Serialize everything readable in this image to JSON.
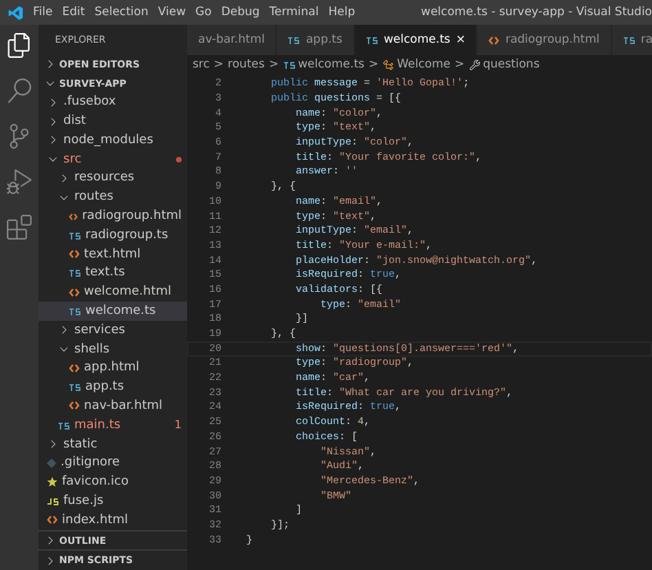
{
  "window": {
    "title": "welcome.ts - survey-app - Visual Studio"
  },
  "menu": [
    "File",
    "Edit",
    "Selection",
    "View",
    "Go",
    "Debug",
    "Terminal",
    "Help"
  ],
  "activity_bar": [
    {
      "kind": "explorer",
      "selected": true
    },
    {
      "kind": "search",
      "selected": false
    },
    {
      "kind": "source-control",
      "selected": false
    },
    {
      "kind": "debug",
      "selected": false
    },
    {
      "kind": "extensions",
      "selected": false
    }
  ],
  "sidebar": {
    "title": "EXPLORER",
    "sections_top": [
      {
        "label": "OPEN EDITORS",
        "expanded": false
      },
      {
        "label": "SURVEY-APP",
        "expanded": true
      }
    ],
    "tree": [
      {
        "label": ".fusebox",
        "kind": "folder",
        "expanded": false
      },
      {
        "label": "dist",
        "kind": "folder",
        "expanded": false
      },
      {
        "label": "node_modules",
        "kind": "folder",
        "expanded": false
      },
      {
        "label": "src",
        "kind": "folder",
        "expanded": true,
        "error": true,
        "children": [
          {
            "label": "resources",
            "kind": "folder",
            "expanded": false
          },
          {
            "label": "routes",
            "kind": "folder",
            "expanded": true,
            "children": [
              {
                "label": "radiogroup.html",
                "kind": "html",
                "selected": false
              },
              {
                "label": "radiogroup.ts",
                "kind": "ts",
                "selected": false
              },
              {
                "label": "text.html",
                "kind": "html",
                "selected": false
              },
              {
                "label": "text.ts",
                "kind": "ts",
                "selected": false
              },
              {
                "label": "welcome.html",
                "kind": "html",
                "selected": false
              },
              {
                "label": "welcome.ts",
                "kind": "ts",
                "selected": true
              }
            ]
          },
          {
            "label": "services",
            "kind": "folder",
            "expanded": false
          },
          {
            "label": "shells",
            "kind": "folder",
            "expanded": true,
            "children": [
              {
                "label": "app.html",
                "kind": "html",
                "selected": false
              },
              {
                "label": "app.ts",
                "kind": "ts",
                "selected": false
              },
              {
                "label": "nav-bar.html",
                "kind": "html",
                "selected": false
              }
            ]
          },
          {
            "label": "main.ts",
            "kind": "ts",
            "selected": false,
            "error": true,
            "badge": "1"
          }
        ]
      },
      {
        "label": "static",
        "kind": "folder",
        "expanded": false
      },
      {
        "label": ".gitignore",
        "kind": "gitignore",
        "selected": false
      },
      {
        "label": "favicon.ico",
        "kind": "ico",
        "selected": false
      },
      {
        "label": "fuse.js",
        "kind": "js",
        "selected": false
      },
      {
        "label": "index.html",
        "kind": "html",
        "selected": false
      }
    ],
    "sections_bottom": [
      {
        "label": "OUTLINE",
        "expanded": false
      },
      {
        "label": "NPM SCRIPTS",
        "expanded": false
      }
    ]
  },
  "tabs": [
    {
      "label": "av-bar.html",
      "selected": false
    },
    {
      "label": "app.ts",
      "kind": "ts",
      "selected": false
    },
    {
      "label": "welcome.ts",
      "kind": "ts",
      "selected": true,
      "close": "×"
    },
    {
      "label": "radiogroup.html",
      "kind": "html",
      "selected": false
    },
    {
      "label": "ra",
      "kind": "ts",
      "selected": false
    }
  ],
  "breadcrumbs": [
    {
      "label": "src",
      "kind": "folder"
    },
    {
      "label": "routes",
      "kind": "folder"
    },
    {
      "label": "welcome.ts",
      "kind": "ts"
    },
    {
      "label": "Welcome",
      "kind": "class"
    },
    {
      "label": "questions",
      "kind": "property"
    }
  ],
  "breadcrumb_separator": ">",
  "code": [
    {
      "n": "2",
      "tokens": [
        {
          "text": "    public ",
          "kind": "kw"
        },
        {
          "text": "message",
          "kind": "prop"
        },
        {
          "text": " = ",
          "kind": "punct"
        },
        {
          "text": "'Hello Gopal!'",
          "kind": "str"
        },
        {
          "text": ";",
          "kind": "punct"
        }
      ]
    },
    {
      "n": "3",
      "tokens": [
        {
          "text": "    public ",
          "kind": "kw"
        },
        {
          "text": "questions",
          "kind": "prop"
        },
        {
          "text": " = [{",
          "kind": "punct"
        }
      ]
    },
    {
      "n": "4",
      "tokens": [
        {
          "text": "        name",
          "kind": "prop"
        },
        {
          "text": ": ",
          "kind": "punct"
        },
        {
          "text": "\"color\"",
          "kind": "str"
        },
        {
          "text": ",",
          "kind": "punct"
        }
      ]
    },
    {
      "n": "5",
      "tokens": [
        {
          "text": "        type",
          "kind": "prop"
        },
        {
          "text": ": ",
          "kind": "punct"
        },
        {
          "text": "\"text\"",
          "kind": "str"
        },
        {
          "text": ",",
          "kind": "punct"
        }
      ]
    },
    {
      "n": "6",
      "tokens": [
        {
          "text": "        inputType",
          "kind": "prop"
        },
        {
          "text": ": ",
          "kind": "punct"
        },
        {
          "text": "\"color\"",
          "kind": "str"
        },
        {
          "text": ",",
          "kind": "punct"
        }
      ]
    },
    {
      "n": "7",
      "tokens": [
        {
          "text": "        title",
          "kind": "prop"
        },
        {
          "text": ": ",
          "kind": "punct"
        },
        {
          "text": "\"Your favorite color:\"",
          "kind": "str"
        },
        {
          "text": ",",
          "kind": "punct"
        }
      ]
    },
    {
      "n": "8",
      "tokens": [
        {
          "text": "        answer",
          "kind": "prop"
        },
        {
          "text": ": ",
          "kind": "punct"
        },
        {
          "text": "''",
          "kind": "str"
        }
      ]
    },
    {
      "n": "9",
      "tokens": [
        {
          "text": "    }, {",
          "kind": "punct"
        }
      ]
    },
    {
      "n": "10",
      "tokens": [
        {
          "text": "        name",
          "kind": "prop"
        },
        {
          "text": ": ",
          "kind": "punct"
        },
        {
          "text": "\"email\"",
          "kind": "str"
        },
        {
          "text": ",",
          "kind": "punct"
        }
      ]
    },
    {
      "n": "11",
      "tokens": [
        {
          "text": "        type",
          "kind": "prop"
        },
        {
          "text": ": ",
          "kind": "punct"
        },
        {
          "text": "\"text\"",
          "kind": "str"
        },
        {
          "text": ",",
          "kind": "punct"
        }
      ]
    },
    {
      "n": "12",
      "tokens": [
        {
          "text": "        inputType",
          "kind": "prop"
        },
        {
          "text": ": ",
          "kind": "punct"
        },
        {
          "text": "\"email\"",
          "kind": "str"
        },
        {
          "text": ",",
          "kind": "punct"
        }
      ]
    },
    {
      "n": "13",
      "tokens": [
        {
          "text": "        title",
          "kind": "prop"
        },
        {
          "text": ": ",
          "kind": "punct"
        },
        {
          "text": "\"Your e-mail:\"",
          "kind": "str"
        },
        {
          "text": ",",
          "kind": "punct"
        }
      ]
    },
    {
      "n": "14",
      "tokens": [
        {
          "text": "        placeHolder",
          "kind": "prop"
        },
        {
          "text": ": ",
          "kind": "punct"
        },
        {
          "text": "\"jon.snow@nightwatch.org\"",
          "kind": "str"
        },
        {
          "text": ",",
          "kind": "punct"
        }
      ]
    },
    {
      "n": "15",
      "tokens": [
        {
          "text": "        isRequired",
          "kind": "prop"
        },
        {
          "text": ": ",
          "kind": "punct"
        },
        {
          "text": "true",
          "kind": "kw"
        },
        {
          "text": ",",
          "kind": "punct"
        }
      ]
    },
    {
      "n": "16",
      "tokens": [
        {
          "text": "        validators",
          "kind": "prop"
        },
        {
          "text": ": [{",
          "kind": "punct"
        }
      ]
    },
    {
      "n": "17",
      "tokens": [
        {
          "text": "            type",
          "kind": "prop"
        },
        {
          "text": ": ",
          "kind": "punct"
        },
        {
          "text": "\"email\"",
          "kind": "str"
        }
      ]
    },
    {
      "n": "18",
      "tokens": [
        {
          "text": "        }]",
          "kind": "punct"
        }
      ]
    },
    {
      "n": "19",
      "tokens": [
        {
          "text": "    }, {",
          "kind": "punct"
        }
      ]
    },
    {
      "n": "20",
      "current": true,
      "tokens": [
        {
          "text": "        show",
          "kind": "prop"
        },
        {
          "text": ": ",
          "kind": "punct"
        },
        {
          "text": "\"questions[0].answer==='red'\"",
          "kind": "str"
        },
        {
          "text": ",",
          "kind": "punct"
        }
      ]
    },
    {
      "n": "21",
      "tokens": [
        {
          "text": "        type",
          "kind": "prop"
        },
        {
          "text": ": ",
          "kind": "punct"
        },
        {
          "text": "\"radiogroup\"",
          "kind": "str"
        },
        {
          "text": ",",
          "kind": "punct"
        }
      ]
    },
    {
      "n": "22",
      "tokens": [
        {
          "text": "        name",
          "kind": "prop"
        },
        {
          "text": ": ",
          "kind": "punct"
        },
        {
          "text": "\"car\"",
          "kind": "str"
        },
        {
          "text": ",",
          "kind": "punct"
        }
      ]
    },
    {
      "n": "23",
      "tokens": [
        {
          "text": "        title",
          "kind": "prop"
        },
        {
          "text": ": ",
          "kind": "punct"
        },
        {
          "text": "\"What car are you driving?\"",
          "kind": "str"
        },
        {
          "text": ",",
          "kind": "punct"
        }
      ]
    },
    {
      "n": "24",
      "tokens": [
        {
          "text": "        isRequired",
          "kind": "prop"
        },
        {
          "text": ": ",
          "kind": "punct"
        },
        {
          "text": "true",
          "kind": "kw"
        },
        {
          "text": ",",
          "kind": "punct"
        }
      ]
    },
    {
      "n": "25",
      "tokens": [
        {
          "text": "        colCount",
          "kind": "prop"
        },
        {
          "text": ": ",
          "kind": "punct"
        },
        {
          "text": "4",
          "kind": "num"
        },
        {
          "text": ",",
          "kind": "punct"
        }
      ]
    },
    {
      "n": "26",
      "tokens": [
        {
          "text": "        choices",
          "kind": "prop"
        },
        {
          "text": ": [",
          "kind": "punct"
        }
      ]
    },
    {
      "n": "27",
      "tokens": [
        {
          "text": "            \"Nissan\"",
          "kind": "str"
        },
        {
          "text": ",",
          "kind": "punct"
        }
      ]
    },
    {
      "n": "28",
      "tokens": [
        {
          "text": "            \"Audi\"",
          "kind": "str"
        },
        {
          "text": ",",
          "kind": "punct"
        }
      ]
    },
    {
      "n": "29",
      "tokens": [
        {
          "text": "            \"Mercedes-Benz\"",
          "kind": "str"
        },
        {
          "text": ",",
          "kind": "punct"
        }
      ]
    },
    {
      "n": "30",
      "tokens": [
        {
          "text": "            \"BMW\"",
          "kind": "str"
        }
      ]
    },
    {
      "n": "31",
      "tokens": [
        {
          "text": "        ]",
          "kind": "punct"
        }
      ]
    },
    {
      "n": "32",
      "tokens": [
        {
          "text": "    }];",
          "kind": "punct"
        }
      ]
    },
    {
      "n": "33",
      "tokens": [
        {
          "text": "}",
          "kind": "punct"
        }
      ]
    }
  ]
}
